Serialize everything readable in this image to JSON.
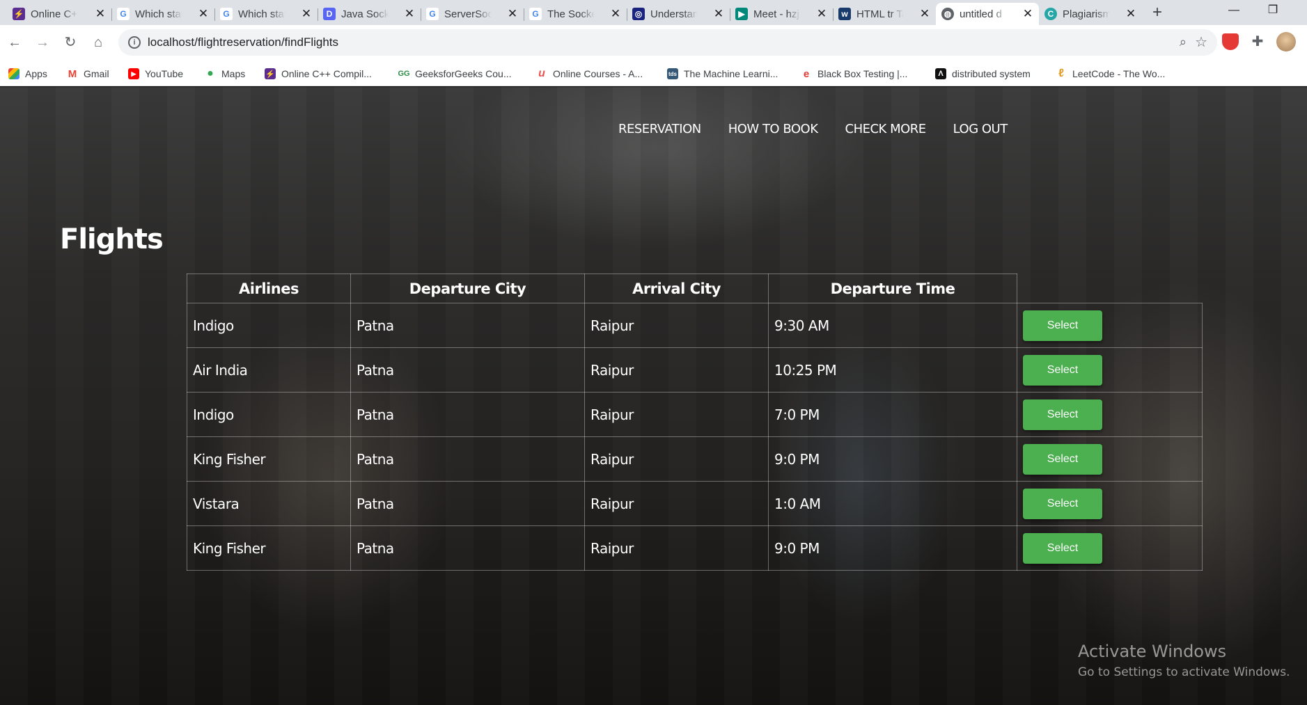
{
  "browser": {
    "tabs": [
      {
        "title": "Online C++",
        "icon": "lightning-icon",
        "color": "#5c2d91"
      },
      {
        "title": "Which stat",
        "icon": "google-icon",
        "color": "#4285f4"
      },
      {
        "title": "Which stat",
        "icon": "google-icon",
        "color": "#4285f4"
      },
      {
        "title": "Java Socke",
        "icon": "d-icon",
        "color": "#5865f2"
      },
      {
        "title": "ServerSock",
        "icon": "google-icon",
        "color": "#4285f4"
      },
      {
        "title": "The Socke",
        "icon": "google-icon",
        "color": "#4285f4"
      },
      {
        "title": "Understan",
        "icon": "target-icon",
        "color": "#1a237e"
      },
      {
        "title": "Meet - hzj",
        "icon": "meet-icon",
        "color": "#00897b"
      },
      {
        "title": "HTML tr Ta",
        "icon": "w3-icon",
        "color": "#1a3a6b"
      },
      {
        "title": "untitled d",
        "icon": "globe-icon",
        "color": "#5f6368"
      },
      {
        "title": "Plagiarism",
        "icon": "c-icon",
        "color": "#26a6a6"
      }
    ],
    "url": "localhost/flightreservation/findFlights",
    "bookmarks": [
      {
        "label": "Apps",
        "icon": "apps-icon"
      },
      {
        "label": "Gmail",
        "icon": "gmail-icon"
      },
      {
        "label": "YouTube",
        "icon": "youtube-icon"
      },
      {
        "label": "Maps",
        "icon": "maps-icon"
      },
      {
        "label": "Online C++ Compil...",
        "icon": "lightning-icon"
      },
      {
        "label": "GeeksforGeeks Cou...",
        "icon": "gfg-icon"
      },
      {
        "label": "Online Courses - A...",
        "icon": "udemy-icon"
      },
      {
        "label": "The Machine Learni...",
        "icon": "tds-icon"
      },
      {
        "label": "Black Box Testing |...",
        "icon": "guru-icon"
      },
      {
        "label": "distributed system",
        "icon": "mit-icon"
      },
      {
        "label": "LeetCode - The Wo...",
        "icon": "leetcode-icon"
      }
    ]
  },
  "nav": {
    "reservation": "RESERVATION",
    "how_to_book": "HOW TO BOOK",
    "check_more": "CHECK MORE",
    "log_out": "LOG OUT"
  },
  "page": {
    "heading": "Flights"
  },
  "table": {
    "headers": [
      "Airlines",
      "Departure City",
      "Arrival City",
      "Departure Time"
    ],
    "button_label": "Select",
    "rows": [
      {
        "airline": "Indigo",
        "departure_city": "Patna",
        "arrival_city": "Raipur",
        "departure_time": "9:30 AM"
      },
      {
        "airline": "Air India",
        "departure_city": "Patna",
        "arrival_city": "Raipur",
        "departure_time": "10:25 PM"
      },
      {
        "airline": "Indigo",
        "departure_city": "Patna",
        "arrival_city": "Raipur",
        "departure_time": "7:0 PM"
      },
      {
        "airline": "King Fisher",
        "departure_city": "Patna",
        "arrival_city": "Raipur",
        "departure_time": "9:0 PM"
      },
      {
        "airline": "Vistara",
        "departure_city": "Patna",
        "arrival_city": "Raipur",
        "departure_time": "1:0 AM"
      },
      {
        "airline": "King Fisher",
        "departure_city": "Patna",
        "arrival_city": "Raipur",
        "departure_time": "9:0 PM"
      }
    ]
  },
  "watermark": {
    "title": "Activate Windows",
    "subtitle": "Go to Settings to activate Windows."
  },
  "colors": {
    "select_button": "#4caf50"
  }
}
